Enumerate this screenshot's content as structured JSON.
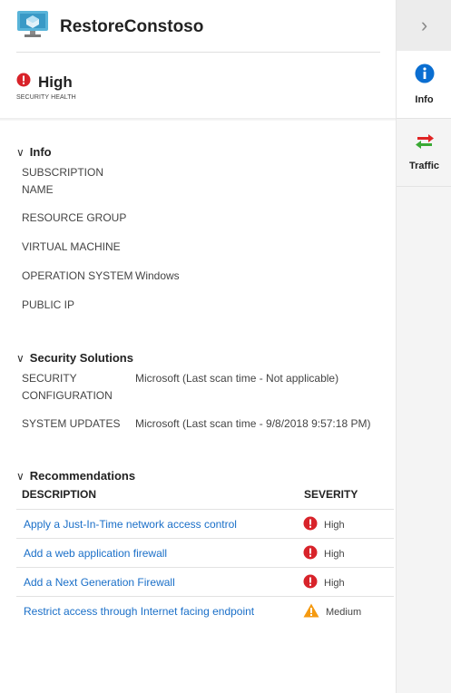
{
  "header": {
    "title": "RestoreConstoso",
    "icon": "virtual-machine-icon"
  },
  "health": {
    "value": "High",
    "label": "SECURITY HEALTH",
    "color": "#d8232a"
  },
  "info": {
    "title": "Info",
    "fields": [
      {
        "key": "SUBSCRIPTION NAME",
        "value": ""
      },
      {
        "key": "RESOURCE GROUP",
        "value": ""
      },
      {
        "key": "VIRTUAL MACHINE",
        "value": ""
      },
      {
        "key": "OPERATION SYSTEM",
        "value": "Windows"
      },
      {
        "key": "PUBLIC IP",
        "value": ""
      }
    ]
  },
  "solutions": {
    "title": "Security Solutions",
    "fields": [
      {
        "key": "SECURITY CONFIGURATION",
        "value": "Microsoft (Last scan time - Not applicable)"
      },
      {
        "key": "SYSTEM UPDATES",
        "value": "Microsoft (Last scan time - 9/8/2018 9:57:18 PM)"
      }
    ]
  },
  "recommendations": {
    "title": "Recommendations",
    "columns": {
      "description": "DESCRIPTION",
      "severity": "SEVERITY"
    },
    "rows": [
      {
        "description": "Apply a Just-In-Time network access control",
        "severity": "High"
      },
      {
        "description": "Add a web application firewall",
        "severity": "High"
      },
      {
        "description": "Add a Next Generation Firewall",
        "severity": "High"
      },
      {
        "description": "Restrict access through Internet facing endpoint",
        "severity": "Medium"
      }
    ]
  },
  "rail": {
    "collapse_icon": "chevron-right-icon",
    "items": [
      {
        "label": "Info",
        "icon": "info-icon",
        "active": true
      },
      {
        "label": "Traffic",
        "icon": "traffic-arrows-icon",
        "active": false
      }
    ]
  },
  "colors": {
    "link": "#1a6fc8",
    "high": "#d8232a",
    "medium": "#f59a10",
    "info_blue": "#0a6ed1"
  }
}
